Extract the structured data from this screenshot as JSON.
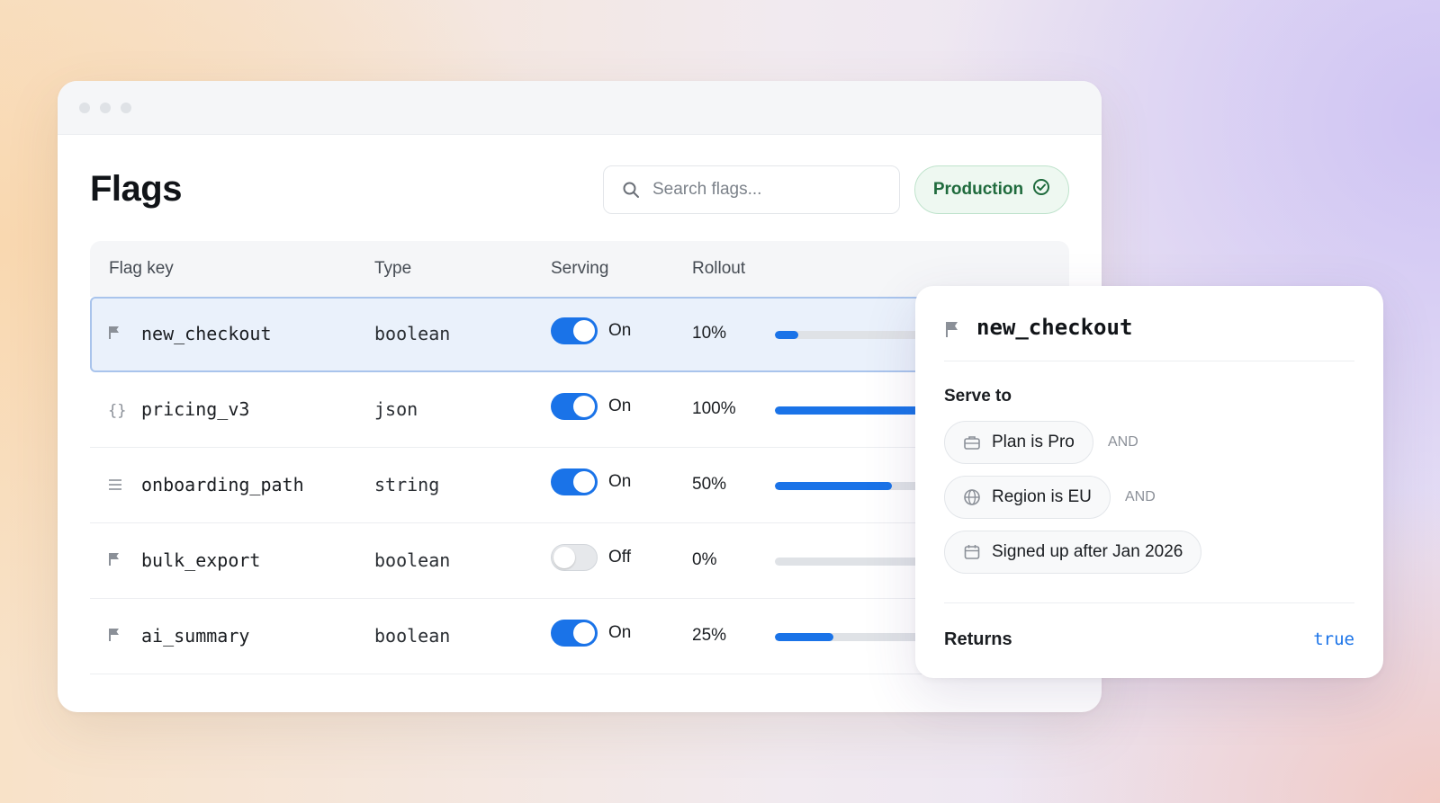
{
  "window": {
    "title": "Flags",
    "search": {
      "placeholder": "Search flags..."
    },
    "environment": {
      "label": "Production",
      "status": "verified",
      "color": "#1f6b3d"
    }
  },
  "table": {
    "columns": [
      "Flag key",
      "Type",
      "Serving",
      "Rollout"
    ],
    "rows": [
      {
        "icon": "flag-icon",
        "key": "new_checkout",
        "type": "boolean",
        "on": true,
        "serving": "On",
        "rollout": "10%",
        "rollout_value": 10,
        "selected": true
      },
      {
        "icon": "braces-icon",
        "key": "pricing_v3",
        "type": "json",
        "on": true,
        "serving": "On",
        "rollout": "100%",
        "rollout_value": 100,
        "selected": false
      },
      {
        "icon": "lines-icon",
        "key": "onboarding_path",
        "type": "string",
        "on": true,
        "serving": "On",
        "rollout": "50%",
        "rollout_value": 50,
        "selected": false
      },
      {
        "icon": "flag-icon",
        "key": "bulk_export",
        "type": "boolean",
        "on": false,
        "serving": "Off",
        "rollout": "0%",
        "rollout_value": 0,
        "selected": false
      },
      {
        "icon": "flag-icon",
        "key": "ai_summary",
        "type": "boolean",
        "on": true,
        "serving": "On",
        "rollout": "25%",
        "rollout_value": 25,
        "selected": false
      }
    ]
  },
  "panel": {
    "flag_key": "new_checkout",
    "serve_to_label": "Serve to",
    "conditions": [
      {
        "icon": "briefcase-icon",
        "label": "Plan is Pro",
        "joiner": "AND"
      },
      {
        "icon": "globe-icon",
        "label": "Region is EU",
        "joiner": "AND"
      },
      {
        "icon": "calendar-icon",
        "label": "Signed up after Jan 2026",
        "joiner": ""
      }
    ],
    "returns_label": "Returns",
    "returns_value": "true"
  },
  "colors": {
    "accent": "#1a73e8",
    "success": "#1f6b3d"
  }
}
